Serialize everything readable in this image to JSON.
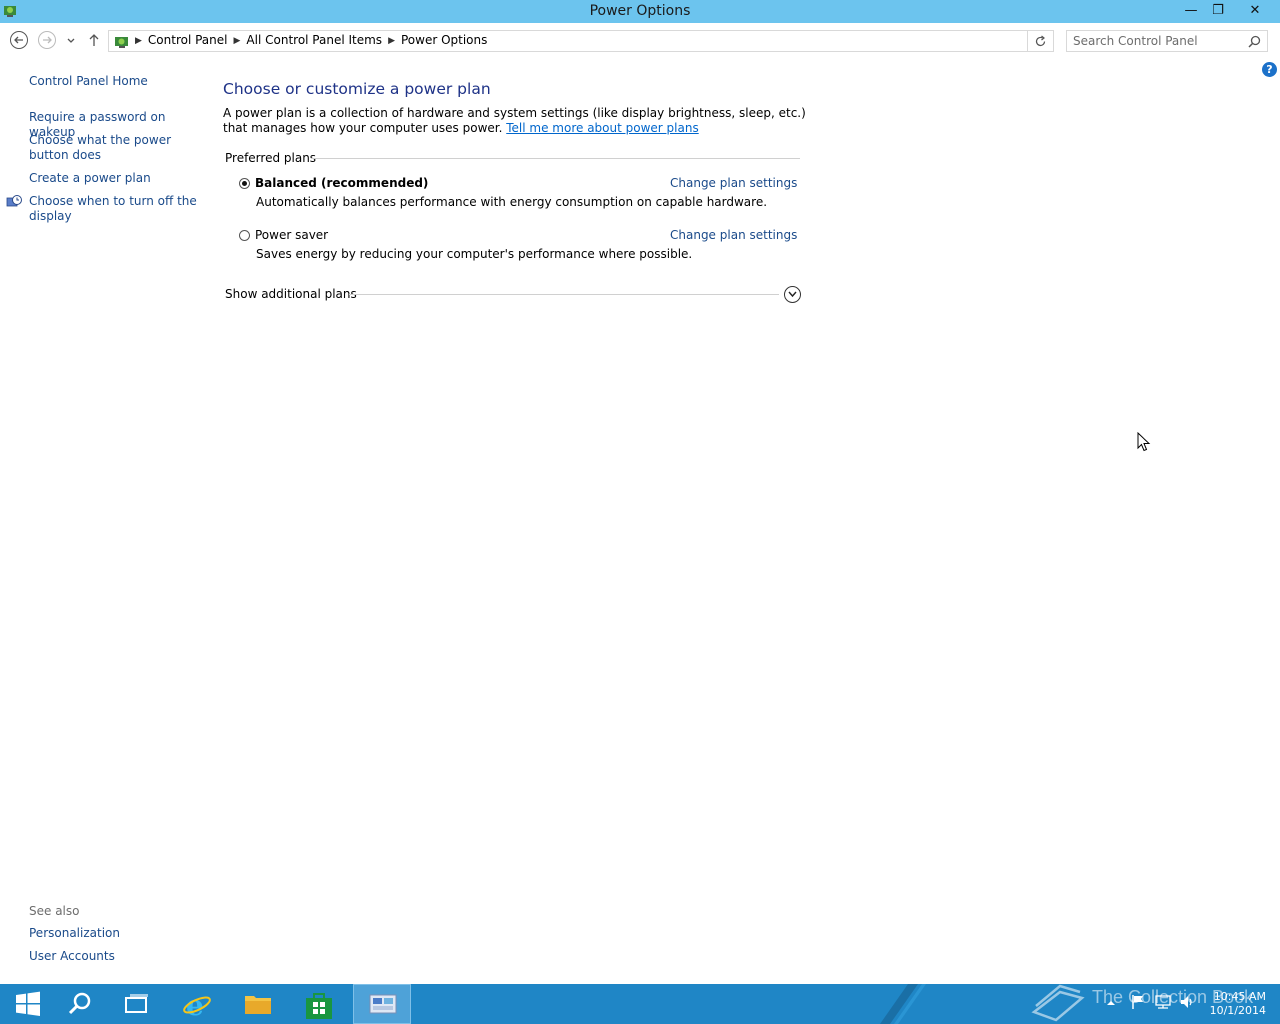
{
  "window": {
    "title": "Power Options",
    "minimize_glyph": "—",
    "maximize_glyph": "❐",
    "close_glyph": "✕"
  },
  "address": {
    "crumbs": [
      "Control Panel",
      "All Control Panel Items",
      "Power Options"
    ],
    "search_placeholder": "Search Control Panel"
  },
  "left_pane": {
    "home": "Control Panel Home",
    "links": [
      "Require a password on wakeup",
      "Choose what the power button does",
      "Create a power plan",
      "Choose when to turn off the display"
    ],
    "see_also_label": "See also",
    "see_also": [
      "Personalization",
      "User Accounts"
    ]
  },
  "main": {
    "title": "Choose or customize a power plan",
    "intro": "A power plan is a collection of hardware and system settings (like display brightness, sleep, etc.) that manages how your computer uses power.",
    "intro_link": "Tell me more about power plans",
    "preferred_label": "Preferred plans",
    "plans": [
      {
        "name": "Balanced (recommended)",
        "description": "Automatically balances performance with energy consumption on capable hardware.",
        "selected": true,
        "change_label": "Change plan settings"
      },
      {
        "name": "Power saver",
        "description": "Saves energy by reducing your computer's performance where possible.",
        "selected": false,
        "change_label": "Change plan settings"
      }
    ],
    "additional_label": "Show additional plans"
  },
  "taskbar": {
    "time": "10:45 AM",
    "date": "10/1/2014",
    "watermark": "The Collection Book"
  },
  "icons": {
    "help": "?",
    "accent": "#1f86c6",
    "title_bar": "#6cc4ee"
  }
}
